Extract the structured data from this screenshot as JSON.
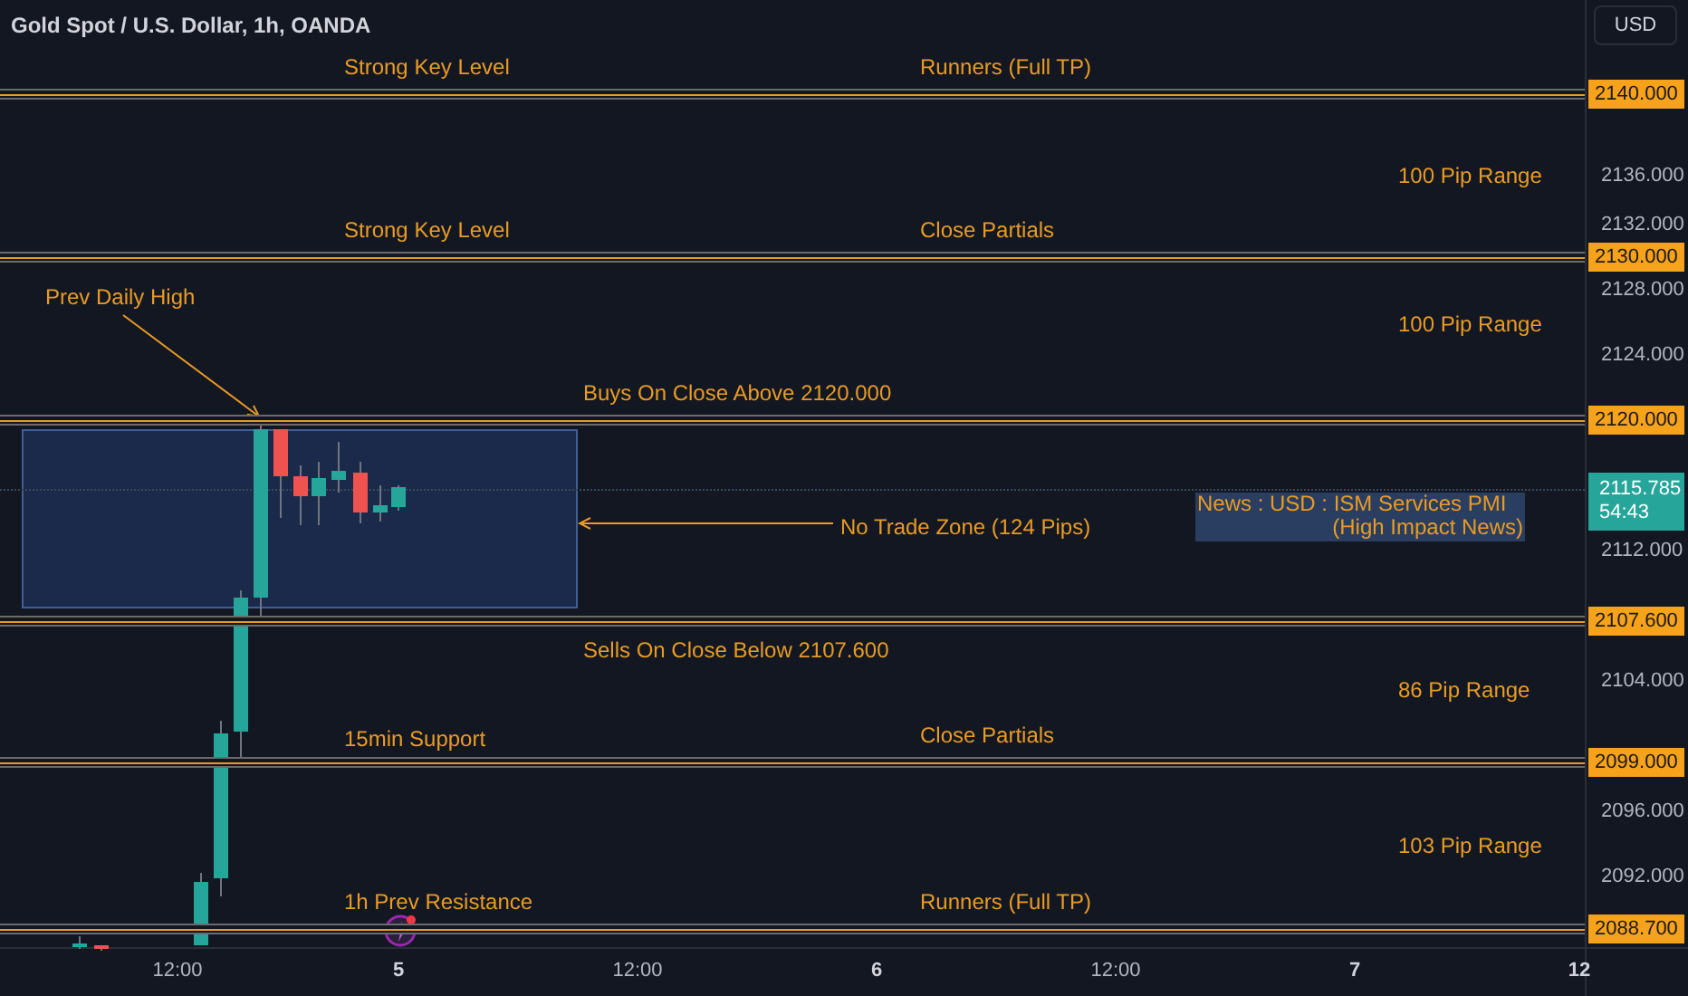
{
  "header": {
    "symbol_title": "Gold Spot / U.S. Dollar, 1h, OANDA",
    "currency_button": "USD"
  },
  "levels": [
    {
      "price_label": "2140.000",
      "notes": [
        "Strong Key Level",
        "Runners (Full TP)"
      ]
    },
    {
      "price_label": "2130.000",
      "notes": [
        "Strong Key Level",
        "Close Partials"
      ]
    },
    {
      "price_label": "2120.000",
      "notes": [
        "Buys On Close Above 2120.000"
      ]
    },
    {
      "price_label": "2107.600",
      "notes": [
        "Sells On Close Below 2107.600"
      ]
    },
    {
      "price_label": "2099.000",
      "notes": [
        "15min Support",
        "Close Partials"
      ]
    },
    {
      "price_label": "2088.700",
      "notes": [
        "1h Prev Resistance",
        "Runners (Full TP)"
      ]
    }
  ],
  "range_labels": [
    "100 Pip Range",
    "100 Pip Range",
    "86 Pip Range",
    "103 Pip Range"
  ],
  "annotations": {
    "prev_daily_high": "Prev Daily High",
    "no_trade_zone": "No Trade Zone (124 Pips)",
    "news_lines": [
      "News : USD : ISM Services PMI",
      "(High Impact News)"
    ]
  },
  "price_axis": [
    "2136.000",
    "2132.000",
    "2128.000",
    "2124.000",
    "2112.000",
    "2104.000",
    "2096.000",
    "2092.000"
  ],
  "current_price": {
    "price": "2115.785",
    "countdown": "54:43"
  },
  "time_axis": [
    "12:00",
    "5",
    "12:00",
    "6",
    "12:00",
    "7",
    "12"
  ]
}
